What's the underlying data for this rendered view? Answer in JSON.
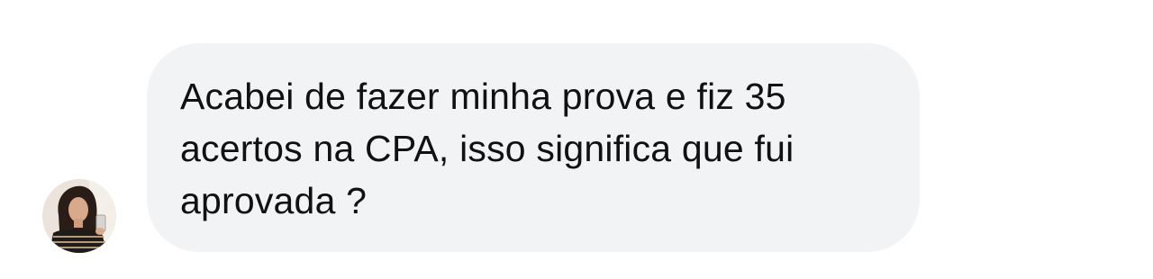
{
  "message": {
    "text": "Acabei de fazer minha prova e fiz 35 acertos na CPA, isso significa que fui aprovada ?",
    "bubble_color": "#f2f3f5",
    "text_color": "#111111"
  },
  "sender": {
    "avatar_icon": "profile-photo"
  }
}
